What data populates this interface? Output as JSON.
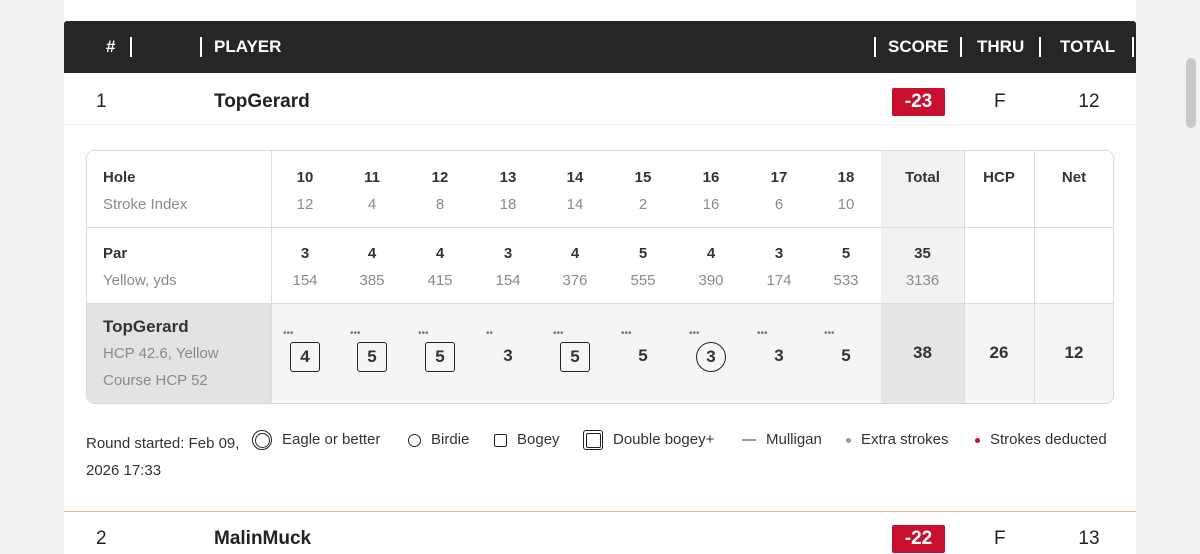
{
  "header": {
    "pos_label": "#",
    "player_label": "PLAYER",
    "score_label": "SCORE",
    "thru_label": "THRU",
    "total_label": "TOTAL"
  },
  "players": [
    {
      "pos": "1",
      "name": "TopGerard",
      "score": "-23",
      "thru": "F",
      "total": "12"
    },
    {
      "pos": "2",
      "name": "MalinMuck",
      "score": "-22",
      "thru": "F",
      "total": "13"
    }
  ],
  "scorecard": {
    "hole_label": "Hole",
    "stroke_index_label": "Stroke Index",
    "par_label": "Par",
    "tee_label": "Yellow, yds",
    "total_label": "Total",
    "hcp_label": "HCP",
    "net_label": "Net",
    "holes": [
      "10",
      "11",
      "12",
      "13",
      "14",
      "15",
      "16",
      "17",
      "18"
    ],
    "stroke_index": [
      "12",
      "4",
      "8",
      "18",
      "14",
      "2",
      "16",
      "6",
      "10"
    ],
    "par": [
      "3",
      "4",
      "4",
      "3",
      "4",
      "5",
      "4",
      "3",
      "5"
    ],
    "yards": [
      "154",
      "385",
      "415",
      "154",
      "376",
      "555",
      "390",
      "174",
      "533"
    ],
    "par_total": "35",
    "yards_total": "3136",
    "player": {
      "name": "TopGerard",
      "hcp_line": "HCP 42.6, Yellow",
      "course_hcp_line": "Course HCP 52",
      "strokes": [
        "4",
        "5",
        "5",
        "3",
        "5",
        "5",
        "3",
        "3",
        "5"
      ],
      "marks": [
        "bogey",
        "bogey",
        "bogey",
        "none",
        "bogey",
        "none",
        "birdie",
        "none",
        "none"
      ],
      "extra_dots": [
        "•••",
        "•••",
        "•••",
        "••",
        "•••",
        "•••",
        "•••",
        "•••",
        "•••"
      ],
      "total": "38",
      "hcp": "26",
      "net": "12"
    }
  },
  "legend": {
    "round_started": "Round started: Feb 09, 2026 17:33",
    "eagle": "Eagle or better",
    "birdie": "Birdie",
    "bogey": "Bogey",
    "double_bogey": "Double bogey+",
    "mulligan": "Mulligan",
    "extra_strokes": "Extra strokes",
    "strokes_deducted": "Strokes deducted"
  },
  "colors": {
    "header_bg": "#262626",
    "score_badge": "#c8102e",
    "deducted_dot": "#c8102e"
  }
}
